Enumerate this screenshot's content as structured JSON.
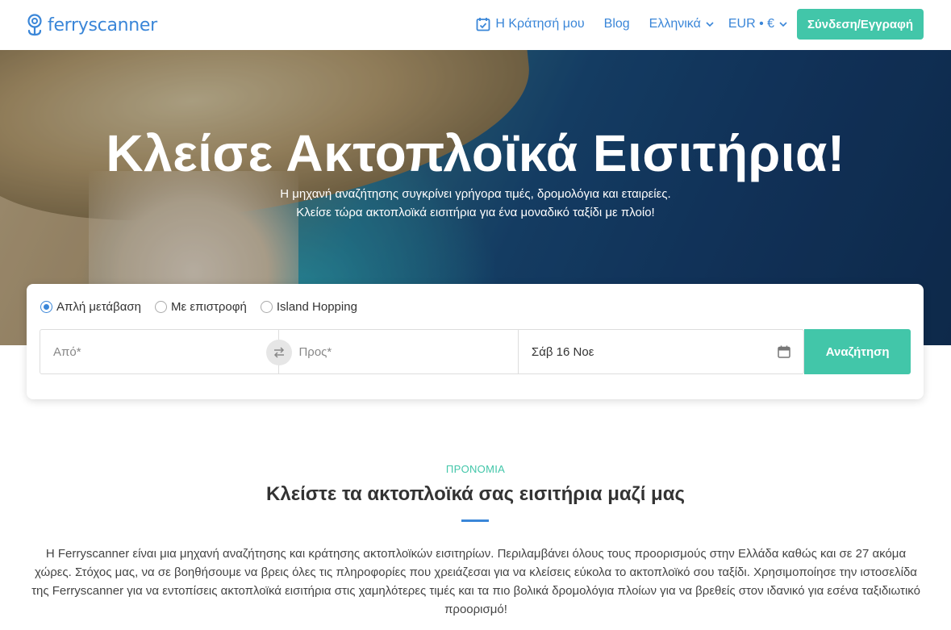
{
  "brand": {
    "name": "ferryscanner",
    "color": "#3a86d8",
    "accent": "#42c6a9"
  },
  "nav": {
    "booking": "Η Κράτησή μου",
    "blog": "Blog",
    "language": "Ελληνικά",
    "currency": "EUR • €",
    "login": "Σύνδεση/Εγγραφή"
  },
  "hero": {
    "title": "Κλείσε Ακτοπλοϊκά Εισιτήρια!",
    "subtitle_line1": "Η μηχανή αναζήτησης συγκρίνει γρήγορα τιμές, δρομολόγια και εταιρείες.",
    "subtitle_line2": "Κλείσε τώρα ακτοπλοϊκά εισιτήρια για ένα μοναδικό ταξίδι με πλοίο!"
  },
  "search": {
    "trip_types": [
      {
        "label": "Απλή μετάβαση",
        "checked": true
      },
      {
        "label": "Με επιστροφή",
        "checked": false
      },
      {
        "label": "Island Hopping",
        "checked": false
      }
    ],
    "from_placeholder": "Από*",
    "to_placeholder": "Προς*",
    "date_value": "Σάβ 16 Νοε",
    "button": "Αναζήτηση"
  },
  "benefits": {
    "eyebrow": "ΠΡΟΝΟΜΙΑ",
    "title": "Κλείστε τα ακτοπλοϊκά σας εισιτήρια μαζί μας",
    "paragraph": "Η Ferryscanner είναι μια μηχανή αναζήτησης και κράτησης ακτοπλοϊκών εισιτηρίων. Περιλαμβάνει όλους τους προορισμούς στην Ελλάδα καθώς και σε 27 ακόμα χώρες. Στόχος μας, να σε βοηθήσουμε να βρεις όλες τις πληροφορίες που χρειάζεσαι για να κλείσεις εύκολα το ακτοπλοϊκό σου ταξίδι. Χρησιμοποίησε την ιστοσελίδα της Ferryscanner για να εντοπίσεις ακτοπλοϊκά εισιτήρια στις χαμηλότερες τιμές και τα πιο βολικά δρομολόγια πλοίων για να βρεθείς στον ιδανικό για εσένα ταξιδιωτικό προορισμό!"
  }
}
